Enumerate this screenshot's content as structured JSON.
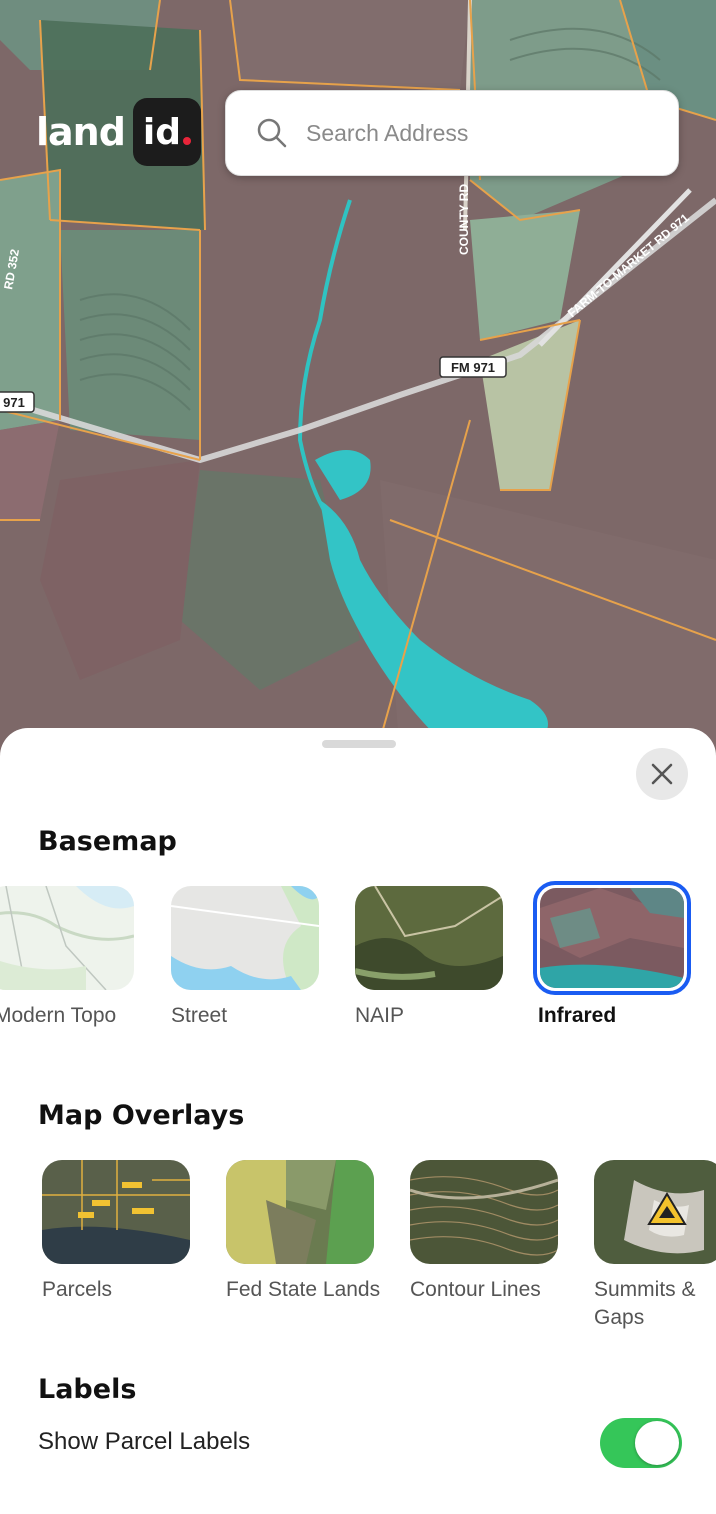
{
  "brand": {
    "logo_word": "land",
    "logo_mark": "id"
  },
  "search": {
    "placeholder": "Search Address",
    "icon": "search-icon"
  },
  "map": {
    "road_labels": [
      "FM 971",
      "971",
      "COUNTY RD",
      "FARM-TO-MARKET RD 971",
      "RD 352"
    ],
    "style": "Infrared"
  },
  "sheet": {
    "close_icon": "close-icon",
    "basemap": {
      "title": "Basemap",
      "items": [
        {
          "label": "Modern Topo",
          "selected": false
        },
        {
          "label": "Street",
          "selected": false
        },
        {
          "label": "NAIP",
          "selected": false
        },
        {
          "label": "Infrared",
          "selected": true
        }
      ]
    },
    "overlays": {
      "title": "Map Overlays",
      "items": [
        {
          "label": "Parcels"
        },
        {
          "label": "Fed State Lands"
        },
        {
          "label": "Contour Lines"
        },
        {
          "label": "Summits & Gaps"
        }
      ]
    },
    "labels": {
      "title": "Labels",
      "show_parcel_labels": "Show Parcel Labels",
      "show_parcel_labels_on": true
    }
  },
  "colors": {
    "accent_blue": "#1a5cf2",
    "toggle_green": "#35c659",
    "brand_red": "#e8253a"
  }
}
